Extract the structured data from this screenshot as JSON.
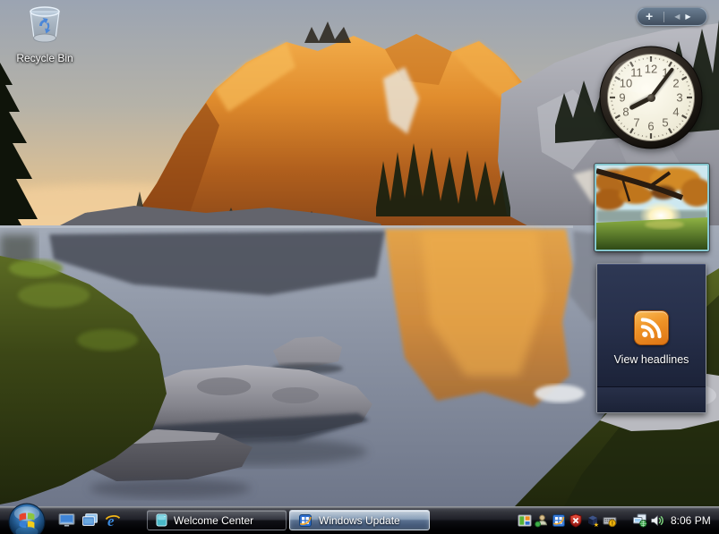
{
  "desktop": {
    "recycle_bin_label": "Recycle Bin"
  },
  "sidebar_controls": {
    "add_gadget": "+",
    "prev": "◀",
    "next": "▶"
  },
  "clock_gadget": {
    "numerals": [
      "1",
      "2",
      "3",
      "4",
      "5",
      "6",
      "7",
      "8",
      "9",
      "10",
      "11",
      "12"
    ],
    "time_shown": "8:06"
  },
  "feed_gadget": {
    "headline_button": "View headlines"
  },
  "taskbar": {
    "buttons": [
      {
        "label": "Welcome Center"
      },
      {
        "label": "Windows Update"
      }
    ],
    "ie_glyph": "e",
    "tray_time": "8:06 PM",
    "tray_icons": [
      "gadgets-icon",
      "user-status-icon",
      "windows-update-icon",
      "security-alert-icon",
      "application-cube-icon",
      "input-status-icon",
      "network-icon",
      "volume-icon"
    ]
  },
  "colors": {
    "taskbar_active_button": "#8aa0b9",
    "orb_blue": "#2f6fae",
    "rss_orange": "#ef9226",
    "photo_frame_teal": "#86c7cf",
    "gadget_panel_navy": "#27304b",
    "clock_face_cream": "#f3f0df",
    "mountain_gold": "#e08c2d",
    "lake_gray_blue": "#8e96a6"
  }
}
